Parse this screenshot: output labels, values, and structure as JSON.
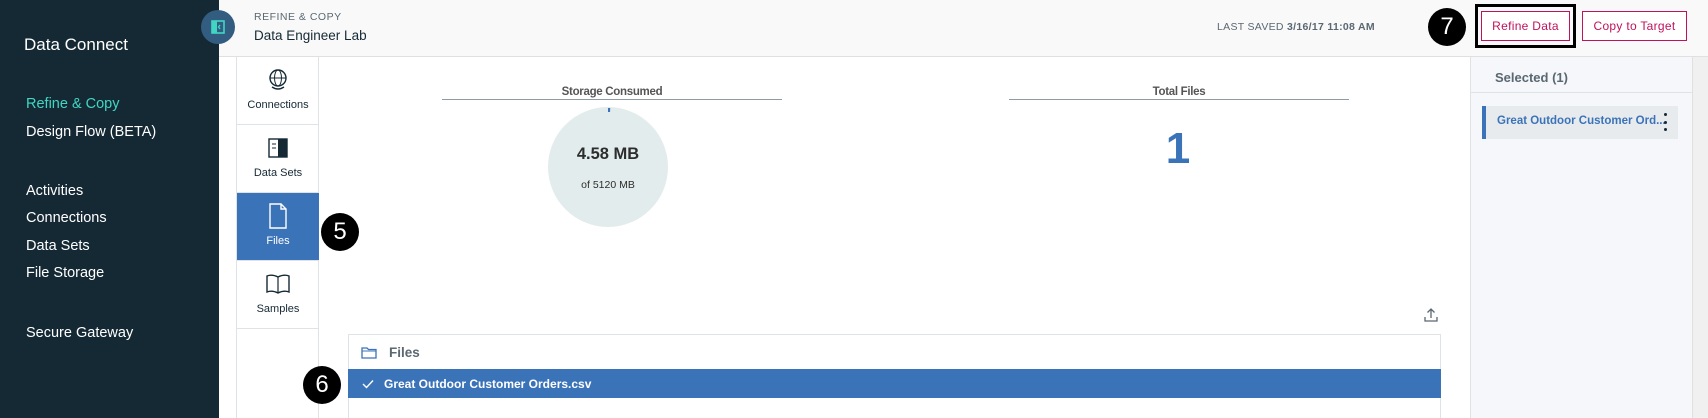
{
  "app": {
    "name": "Data Connect"
  },
  "sidebar": {
    "items": [
      {
        "label": "Refine & Copy"
      },
      {
        "label": "Design Flow (BETA)"
      },
      {
        "label": "Activities"
      },
      {
        "label": "Connections"
      },
      {
        "label": "Data Sets"
      },
      {
        "label": "File Storage"
      },
      {
        "label": "Secure Gateway"
      }
    ]
  },
  "header": {
    "breadcrumb": "REFINE & COPY",
    "project": "Data Engineer Lab",
    "saved_label": "LAST SAVED",
    "saved_value": "3/16/17 11:08 AM",
    "refine_label": "Refine Data",
    "copy_label": "Copy to Target"
  },
  "tabs": [
    {
      "label": "Connections",
      "icon": "globe-icon"
    },
    {
      "label": "Data Sets",
      "icon": "book-icon"
    },
    {
      "label": "Files",
      "icon": "document-icon"
    },
    {
      "label": "Samples",
      "icon": "open-book-icon"
    }
  ],
  "stats": {
    "storage_title": "Storage Consumed",
    "storage_value": "4.58 MB",
    "storage_sub": "of 5120 MB",
    "storage_used_fraction": 0.0009,
    "total_title": "Total Files",
    "total_value": "1"
  },
  "files": {
    "heading": "Files",
    "rows": [
      {
        "name": "Great Outdoor Customer Orders.csv"
      }
    ]
  },
  "selected": {
    "title": "Selected (1)",
    "items": [
      {
        "name": "Great Outdoor Customer Ord..."
      }
    ]
  },
  "callouts": {
    "c5": "5",
    "c6": "6",
    "c7": "7"
  },
  "colors": {
    "sidebar": "#152935",
    "active_nav": "#41d6c3",
    "accent_blue": "#3b73b9",
    "magenta": "#c0115b"
  }
}
